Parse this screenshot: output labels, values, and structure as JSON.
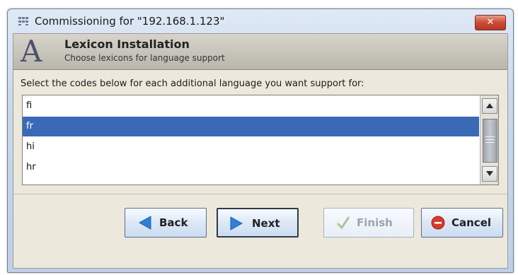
{
  "window": {
    "title": "Commissioning for \"192.168.1.123\"",
    "close_label": "✕"
  },
  "header": {
    "logo_letter": "A",
    "title": "Lexicon Installation",
    "subtitle": "Choose lexicons for language support"
  },
  "instruction": "Select the codes below for each additional language you want support for:",
  "language_list": {
    "items": [
      {
        "code": "fi",
        "selected": false
      },
      {
        "code": "fr",
        "selected": true
      },
      {
        "code": "hi",
        "selected": false
      },
      {
        "code": "hr",
        "selected": false
      }
    ]
  },
  "buttons": {
    "back": "Back",
    "next": "Next",
    "finish": "Finish",
    "cancel": "Cancel"
  },
  "colors": {
    "selection": "#3a69b5",
    "arrow_blue": "#2f7fd8",
    "cancel_red": "#d63b2d",
    "finish_disabled": "#a9c6a0"
  },
  "icons": {
    "title": "network-grid-icon",
    "back": "arrow-left-icon",
    "next": "arrow-right-icon",
    "finish": "checkmark-icon",
    "cancel": "cancel-circle-icon"
  }
}
